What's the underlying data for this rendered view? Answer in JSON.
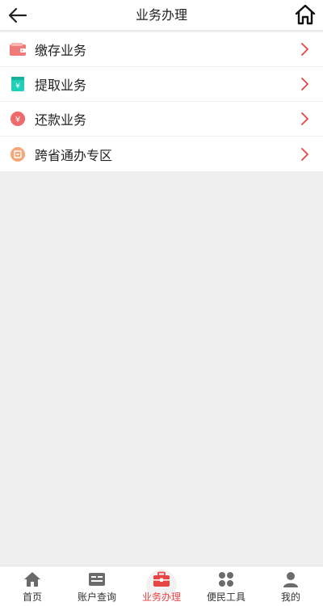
{
  "header": {
    "title": "业务办理"
  },
  "menu": [
    {
      "label": "缴存业务",
      "icon": "wallet-icon"
    },
    {
      "label": "提取业务",
      "icon": "yuan-box-icon"
    },
    {
      "label": "还款业务",
      "icon": "yuan-circle-icon"
    },
    {
      "label": "跨省通办专区",
      "icon": "loan-badge-icon"
    }
  ],
  "tabbar": [
    {
      "label": "首页",
      "icon": "home-icon",
      "active": false
    },
    {
      "label": "账户查询",
      "icon": "account-card-icon",
      "active": false
    },
    {
      "label": "业务办理",
      "icon": "briefcase-icon",
      "active": true
    },
    {
      "label": "便民工具",
      "icon": "grid-icon",
      "active": false
    },
    {
      "label": "我的",
      "icon": "user-icon",
      "active": false
    }
  ],
  "colors": {
    "accent": "#e84545",
    "icon_gray": "#6b6b6b"
  }
}
